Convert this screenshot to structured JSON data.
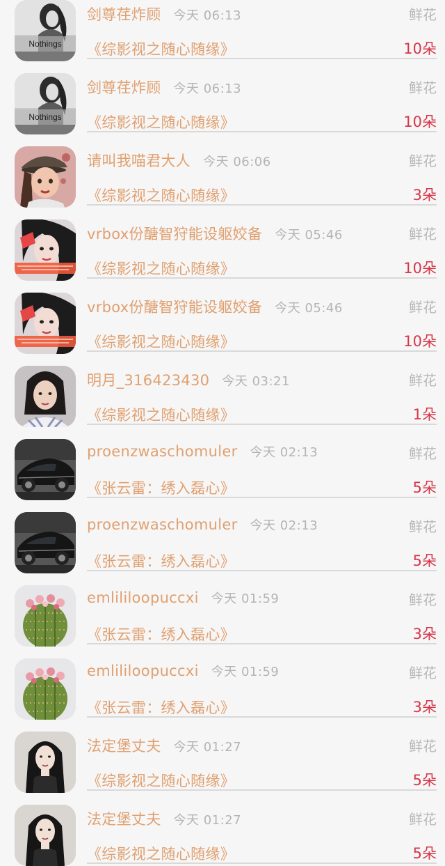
{
  "records": [
    {
      "name": "剑尊荏炸顾",
      "time": "今天 06:13",
      "gift": "鲜花",
      "work": "《综影视之随心随缘》",
      "count": "10朵",
      "avatar": "nothings-bw-girl",
      "avatar_text": "Nothings"
    },
    {
      "name": "剑尊荏炸顾",
      "time": "今天 06:13",
      "gift": "鲜花",
      "work": "《综影视之随心随缘》",
      "count": "10朵",
      "avatar": "nothings-bw-girl",
      "avatar_text": "Nothings"
    },
    {
      "name": "请叫我喵君大人",
      "time": "今天 06:06",
      "gift": "鲜花",
      "work": "《综影视之随心随缘》",
      "count": "3朵",
      "avatar": "cartoon-girl-cap"
    },
    {
      "name": "vrbox份醣智狩能设躯姣备",
      "time": "今天 05:46",
      "gift": "鲜花",
      "work": "《综影视之随心随缘》",
      "count": "10朵",
      "avatar": "girl-selfie-red"
    },
    {
      "name": "vrbox份醣智狩能设躯姣备",
      "time": "今天 05:46",
      "gift": "鲜花",
      "work": "《综影视之随心随缘》",
      "count": "10朵",
      "avatar": "girl-selfie-red"
    },
    {
      "name": "明月_316423430",
      "time": "今天 03:21",
      "gift": "鲜花",
      "work": "《综影视之随心随缘》",
      "count": "1朵",
      "avatar": "girl-portrait"
    },
    {
      "name": "proenzwaschomuler",
      "time": "今天 02:13",
      "gift": "鲜花",
      "work": "《张云雷：绣入磊心》",
      "count": "5朵",
      "avatar": "black-sports-car"
    },
    {
      "name": "proenzwaschomuler",
      "time": "今天 02:13",
      "gift": "鲜花",
      "work": "《张云雷：绣入磊心》",
      "count": "5朵",
      "avatar": "black-sports-car"
    },
    {
      "name": "emlililoopuccxi",
      "time": "今天 01:59",
      "gift": "鲜花",
      "work": "《张云雷：绣入磊心》",
      "count": "3朵",
      "avatar": "cactus-flowers"
    },
    {
      "name": "emlililoopuccxi",
      "time": "今天 01:59",
      "gift": "鲜花",
      "work": "《张云雷：绣入磊心》",
      "count": "3朵",
      "avatar": "cactus-flowers"
    },
    {
      "name": "法定堡丈夫",
      "time": "今天 01:27",
      "gift": "鲜花",
      "work": "《综影视之随心随缘》",
      "count": "5朵",
      "avatar": "girl-long-hair"
    },
    {
      "name": "法定堡丈夫",
      "time": "今天 01:27",
      "gift": "鲜花",
      "work": "《综影视之随心随缘》",
      "count": "5朵",
      "avatar": "girl-long-hair"
    }
  ]
}
